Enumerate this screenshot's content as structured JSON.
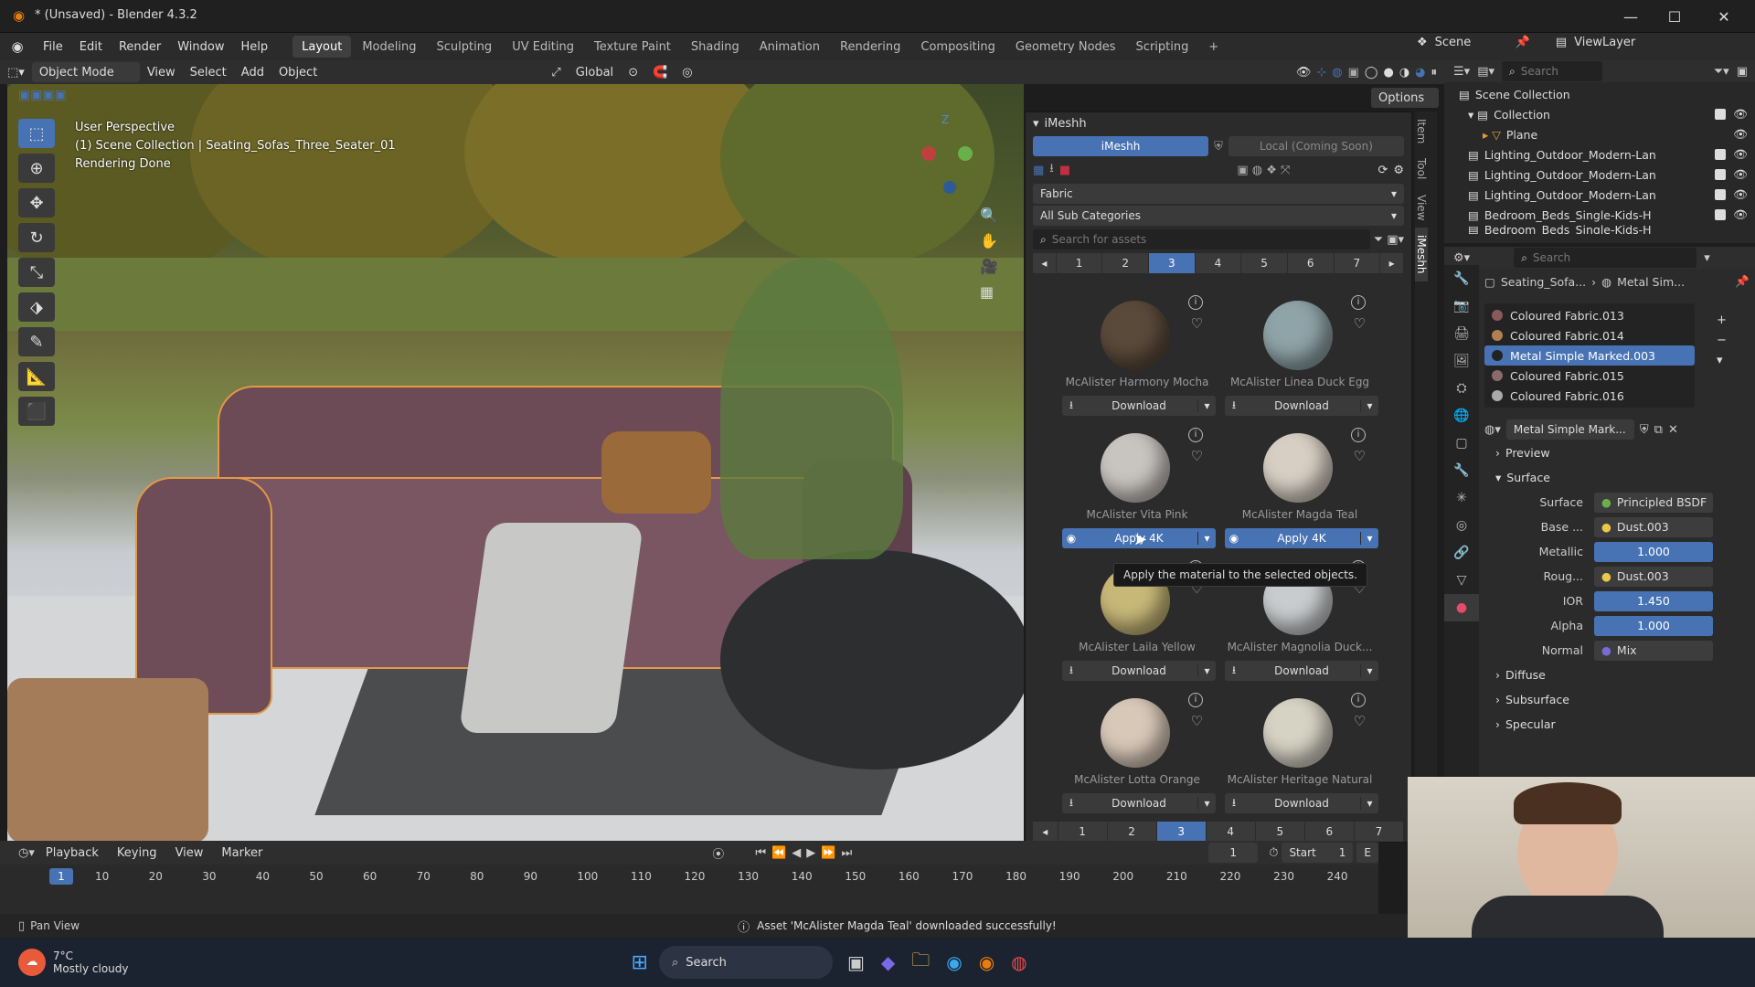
{
  "window": {
    "title": "* (Unsaved) - Blender 4.3.2",
    "minimize": "—",
    "maximize": "☐",
    "close": "✕"
  },
  "menus": [
    "File",
    "Edit",
    "Render",
    "Window",
    "Help"
  ],
  "workspaces": [
    "Layout",
    "Modeling",
    "Sculpting",
    "UV Editing",
    "Texture Paint",
    "Shading",
    "Animation",
    "Rendering",
    "Compositing",
    "Geometry Nodes",
    "Scripting"
  ],
  "active_workspace": "Layout",
  "topright": {
    "scene": "Scene",
    "view_layer": "ViewLayer"
  },
  "header": {
    "mode": "Object Mode",
    "view": "View",
    "select": "Select",
    "add": "Add",
    "object": "Object",
    "orientation": "Global",
    "options": "Options"
  },
  "viewport": {
    "perspective": "User Perspective",
    "collection": "(1) Scene Collection | Seating_Sofas_Three_Seater_01",
    "status": "Rendering Done"
  },
  "imeshh": {
    "title": "iMeshh",
    "tab_active": "iMeshh",
    "tab_other": "Local (Coming Soon)",
    "category": "Fabric",
    "subcategory": "All Sub Categories",
    "search_placeholder": "Search for assets",
    "pages": [
      "1",
      "2",
      "3",
      "4",
      "5",
      "6",
      "7"
    ],
    "current_page": "3",
    "assets": [
      {
        "name": "McAlister Harmony Mocha",
        "button": "Download",
        "color": "#5a4a3a"
      },
      {
        "name": "McAlister Linea Duck Egg",
        "button": "Download",
        "color": "#8fa4a8"
      },
      {
        "name": "McAlister Vita Pink",
        "button": "Apply 4K",
        "color": "#c8c4c0"
      },
      {
        "name": "McAlister Magda Teal",
        "button": "Apply 4K",
        "color": "#d8cfc4"
      },
      {
        "name": "McAlister Laila Yellow",
        "button": "Download",
        "color": "#c8b878"
      },
      {
        "name": "McAlister Magnolia Duck...",
        "button": "Download",
        "color": "#c9ccce"
      },
      {
        "name": "McAlister Lotta Orange",
        "button": "Download",
        "color": "#d8c8b8"
      },
      {
        "name": "McAlister Heritage Natural",
        "button": "Download",
        "color": "#d6d2c4"
      }
    ],
    "tooltip": "Apply the material to the selected objects."
  },
  "sidetabs": [
    "Item",
    "Tool",
    "View",
    "iMeshh"
  ],
  "outliner": {
    "search_placeholder": "Search",
    "rows": [
      {
        "label": "Scene Collection",
        "indent": 0
      },
      {
        "label": "Collection",
        "indent": 1
      },
      {
        "label": "Plane",
        "indent": 2
      },
      {
        "label": "Lighting_Outdoor_Modern-Lan",
        "indent": 1
      },
      {
        "label": "Lighting_Outdoor_Modern-Lan",
        "indent": 1
      },
      {
        "label": "Lighting_Outdoor_Modern-Lan",
        "indent": 1
      },
      {
        "label": "Bedroom_Beds_Single-Kids-H",
        "indent": 1
      },
      {
        "label": "Bedroom_Beds_Single-Kids-H",
        "indent": 1
      }
    ]
  },
  "properties": {
    "search_placeholder": "Search",
    "breadcrumb": [
      "Seating_Sofa...",
      "Metal Sim..."
    ],
    "slots": [
      {
        "label": "Coloured Fabric.013",
        "color": "#8a5a5a"
      },
      {
        "label": "Coloured Fabric.014",
        "color": "#b08050"
      },
      {
        "label": "Metal Simple Marked.003",
        "color": "#222222"
      },
      {
        "label": "Coloured Fabric.015",
        "color": "#8a6a6a"
      },
      {
        "label": "Coloured Fabric.016",
        "color": "#aaaaaa"
      }
    ],
    "selected_slot": 2,
    "material_name": "Metal Simple Mark...",
    "preview": "Preview",
    "surface": "Surface",
    "surface_row": {
      "label": "Surface",
      "value": "Principled BSDF"
    },
    "params": [
      {
        "label": "Base ...",
        "value": "Dust.003",
        "num": false
      },
      {
        "label": "Metallic",
        "value": "1.000",
        "num": true
      },
      {
        "label": "Roug...",
        "value": "Dust.003",
        "num": false
      },
      {
        "label": "IOR",
        "value": "1.450",
        "num": true
      },
      {
        "label": "Alpha",
        "value": "1.000",
        "num": true
      },
      {
        "label": "Normal",
        "value": "Mix",
        "num": false
      }
    ],
    "sections": [
      "Diffuse",
      "Subsurface",
      "Specular"
    ]
  },
  "timeline": {
    "menus": [
      "Playback",
      "Keying",
      "View",
      "Marker"
    ],
    "frame": "1",
    "start_label": "Start",
    "start": "1",
    "end_label": "E",
    "ticks": [
      "1",
      "10",
      "20",
      "30",
      "40",
      "50",
      "60",
      "70",
      "80",
      "90",
      "100",
      "110",
      "120",
      "130",
      "140",
      "150",
      "160",
      "170",
      "180",
      "190",
      "200",
      "210",
      "220",
      "230",
      "240"
    ]
  },
  "status": {
    "left": "Pan View",
    "message": "Asset 'McAlister Magda Teal' downloaded successfully!"
  },
  "taskbar": {
    "temp": "7°C",
    "weather": "Mostly cloudy",
    "search": "Search"
  }
}
